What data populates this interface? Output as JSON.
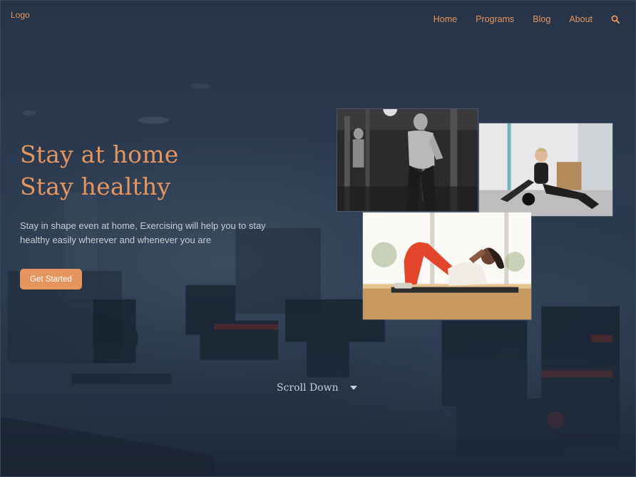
{
  "header": {
    "logo": "Logo",
    "nav": [
      "Home",
      "Programs",
      "Blog",
      "About"
    ],
    "search_icon": "search-icon"
  },
  "hero": {
    "headline_line1": "Stay at home",
    "headline_line2": "Stay healthy",
    "subtitle": "Stay in shape even at home, Exercising will help you to stay healthy easily wherever and whenever you are",
    "cta_label": "Get Started",
    "scroll_label": "Scroll Down"
  },
  "colors": {
    "accent": "#e6955e",
    "background": "#26334a",
    "text_muted": "#c8ccd4"
  }
}
